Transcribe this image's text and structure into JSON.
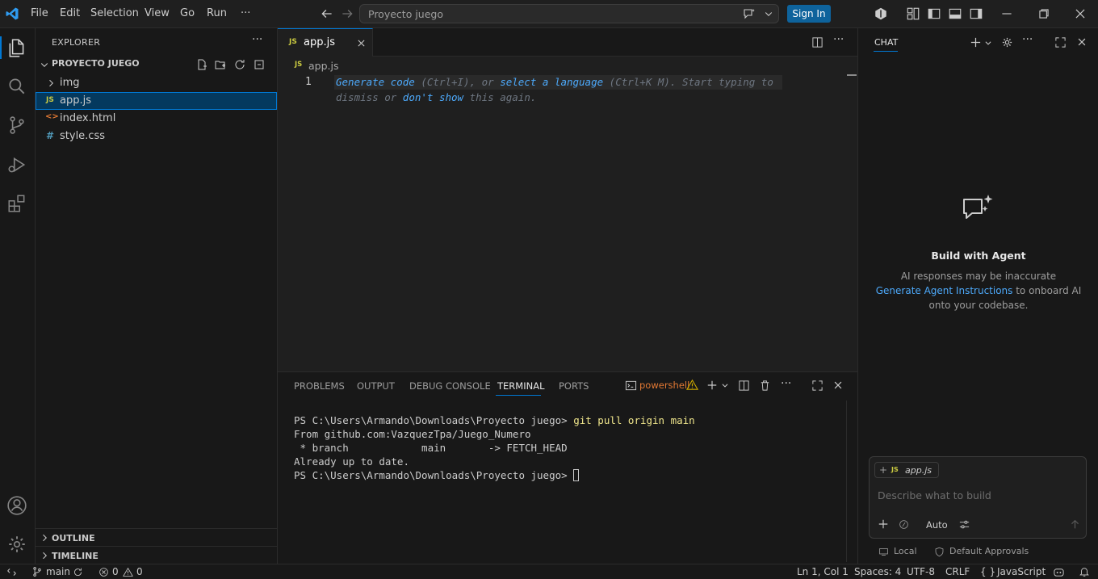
{
  "menu": [
    "File",
    "Edit",
    "Selection",
    "View",
    "Go",
    "Run",
    "···"
  ],
  "command_center": {
    "text": "Proyecto juego"
  },
  "signin_label": "Sign In",
  "explorer": {
    "title": "EXPLORER",
    "folder": "PROYECTO JUEGO",
    "items": [
      {
        "label": "img",
        "type": "folder"
      },
      {
        "label": "app.js",
        "type": "js",
        "icon_text": "JS"
      },
      {
        "label": "index.html",
        "type": "html",
        "icon_text": "<>"
      },
      {
        "label": "style.css",
        "type": "css",
        "icon_text": "#"
      }
    ],
    "outline": "OUTLINE",
    "timeline": "TIMELINE"
  },
  "editor": {
    "tab_label": "app.js",
    "tab_icon_text": "JS",
    "breadcrumb": "app.js",
    "line_number": "1",
    "hint": {
      "generate_code": "Generate code",
      "ctrl_i": " (Ctrl+I), or ",
      "select_language": "select a language",
      "ctrl_k_m": " (Ctrl+K M). Start typing to",
      "dismiss_or": "dismiss or ",
      "dont_show": "don't show",
      "this_again": " this again."
    }
  },
  "panel": {
    "tabs": [
      "PROBLEMS",
      "OUTPUT",
      "DEBUG CONSOLE",
      "TERMINAL",
      "PORTS"
    ],
    "active_tab": "TERMINAL",
    "shell": "powershell",
    "terminal": {
      "prompt1": "PS C:\\Users\\Armando\\Downloads\\Proyecto juego> ",
      "cmd1": "git pull origin main",
      "line2": "From github.com:VazquezTpa/Juego_Numero",
      "line3": " * branch            main       -> FETCH_HEAD",
      "line4": "Already up to date.",
      "prompt2": "PS C:\\Users\\Armando\\Downloads\\Proyecto juego> "
    }
  },
  "chat": {
    "title": "CHAT",
    "heading": "Build with Agent",
    "line1": "AI responses may be inaccurate",
    "link": "Generate Agent Instructions",
    "line2_rest": " to onboard AI",
    "line3": "onto your codebase.",
    "context_chip": "app.js",
    "context_icon_text": "JS",
    "input_placeholder": "Describe what to build",
    "mode": "Auto",
    "local": "Local",
    "approvals": "Default Approvals"
  },
  "status": {
    "branch": "main",
    "errors": "0",
    "warnings": "0",
    "position": "Ln 1, Col 1",
    "spaces": "Spaces: 4",
    "encoding": "UTF-8",
    "eol": "CRLF",
    "language": "JavaScript",
    "lang_brace": "{ }"
  },
  "colors": {
    "accent": "#0078d4",
    "signin_bg": "#0e639c",
    "js_yellow": "#cbcb41",
    "html_orange": "#e37933",
    "css_blue": "#519aba",
    "link_blue": "#4daafc",
    "warning": "#cca700"
  }
}
